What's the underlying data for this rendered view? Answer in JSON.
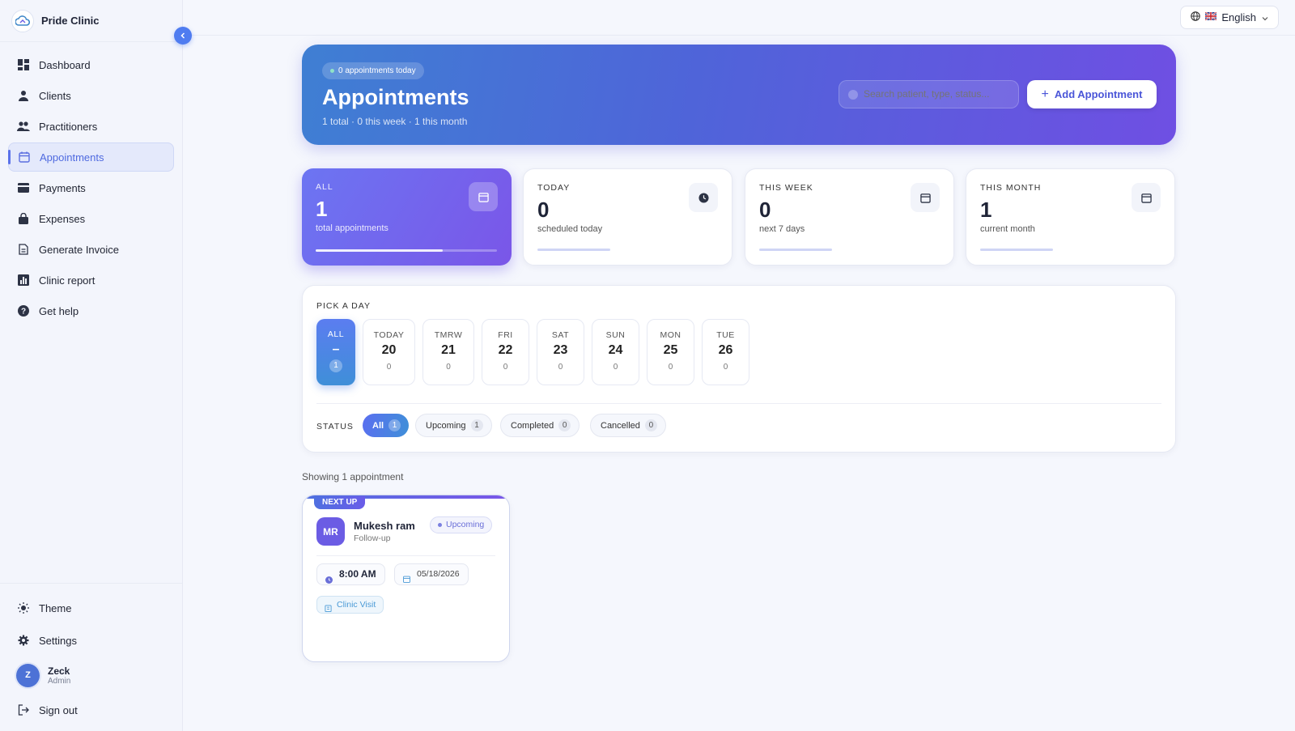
{
  "brand": {
    "name": "Pride Clinic"
  },
  "sidebar": {
    "items": [
      {
        "label": "Dashboard",
        "icon": "dashboard-icon"
      },
      {
        "label": "Clients",
        "icon": "person-icon"
      },
      {
        "label": "Practitioners",
        "icon": "people-icon"
      },
      {
        "label": "Appointments",
        "icon": "calendar-icon",
        "active": true
      },
      {
        "label": "Payments",
        "icon": "credit-card-icon"
      },
      {
        "label": "Expenses",
        "icon": "bag-icon"
      },
      {
        "label": "Generate Invoice",
        "icon": "document-icon"
      },
      {
        "label": "Clinic report",
        "icon": "report-icon"
      },
      {
        "label": "Get help",
        "icon": "help-icon"
      }
    ],
    "theme_label": "Theme",
    "settings_label": "Settings",
    "user": {
      "initial": "Z",
      "name": "Zeck",
      "role": "Admin"
    },
    "signout_label": "Sign out"
  },
  "topbar": {
    "language": "English"
  },
  "hero": {
    "pill": "0 appointments today",
    "title": "Appointments",
    "subtitle": "1 total · 0 this week · 1 this month",
    "search_placeholder": "Search patient, type, status...",
    "add_label": "Add Appointment"
  },
  "stats": [
    {
      "label": "ALL",
      "value": "1",
      "desc": "total appointments",
      "progress": 0.7
    },
    {
      "label": "TODAY",
      "value": "0",
      "desc": "scheduled today"
    },
    {
      "label": "THIS WEEK",
      "value": "0",
      "desc": "next 7 days"
    },
    {
      "label": "THIS MONTH",
      "value": "1",
      "desc": "current month"
    }
  ],
  "picker": {
    "title": "PICK A DAY",
    "days": [
      {
        "label": "ALL",
        "num": "–",
        "count": "1"
      },
      {
        "label": "TODAY",
        "num": "20",
        "count": "0"
      },
      {
        "label": "TMRW",
        "num": "21",
        "count": "0"
      },
      {
        "label": "FRI",
        "num": "22",
        "count": "0"
      },
      {
        "label": "SAT",
        "num": "23",
        "count": "0"
      },
      {
        "label": "SUN",
        "num": "24",
        "count": "0"
      },
      {
        "label": "MON",
        "num": "25",
        "count": "0"
      },
      {
        "label": "TUE",
        "num": "26",
        "count": "0"
      }
    ],
    "status_label": "STATUS",
    "statuses": [
      {
        "label": "All",
        "count": "1"
      },
      {
        "label": "Upcoming",
        "count": "1"
      },
      {
        "label": "Completed",
        "count": "0"
      },
      {
        "label": "Cancelled",
        "count": "0"
      }
    ]
  },
  "list": {
    "showing": "Showing 1 appointment",
    "cards": [
      {
        "tag": "NEXT UP",
        "initials": "MR",
        "name": "Mukesh ram",
        "type": "Follow-up",
        "status": "Upcoming",
        "time": "8:00 AM",
        "date": "05/18/2026",
        "visit": "Clinic Visit"
      }
    ]
  },
  "colors": {
    "accent": "#5b6ae8",
    "brand_gradient_start": "#3f7fd3",
    "brand_gradient_end": "#6f4fe3"
  }
}
